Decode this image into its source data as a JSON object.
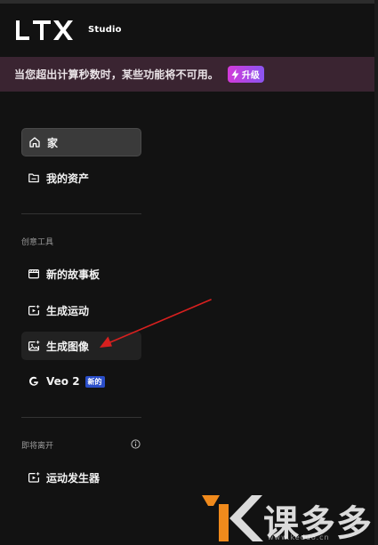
{
  "app": {
    "logo_text": "LTX",
    "logo_sub": "Studio"
  },
  "banner": {
    "message": "当您超出计算秒数时，某些功能将不可用。",
    "upgrade_label": "升级"
  },
  "nav": {
    "home": "家",
    "assets": "我的资产",
    "creative_tools_label": "创意工具",
    "storyboard": "新的故事板",
    "gen_motion": "生成运动",
    "gen_image": "生成图像",
    "veo": "Veo 2",
    "veo_badge": "新的",
    "coming_soon_label": "即将离开",
    "motion_generator": "运动发生器"
  },
  "watermark": {
    "brand": "课多多",
    "url": "www.keduo.cn"
  },
  "colors": {
    "background": "#121212",
    "banner_bg": "#3a2431",
    "active_item": "#3a3a3a",
    "badge_blue": "#2a4ec9",
    "annotation_red": "#d8201f",
    "watermark_orange": "#f08a1c"
  }
}
